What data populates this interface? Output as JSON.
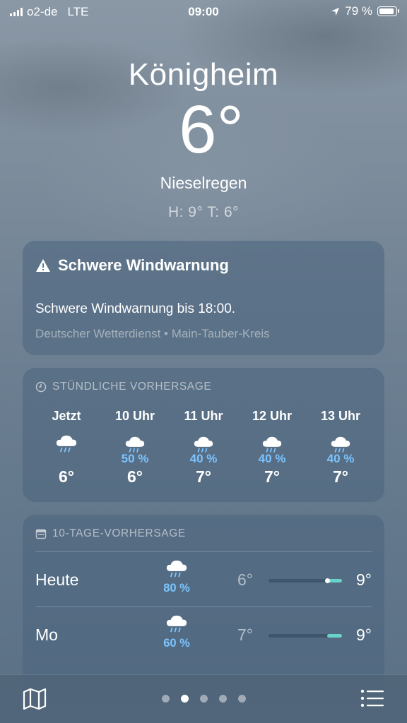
{
  "status_bar": {
    "carrier": "o2-de",
    "network": "LTE",
    "time": "09:00",
    "battery": "79 %"
  },
  "header": {
    "city": "Königheim",
    "temperature": "6°",
    "condition": "Nieselregen",
    "high_low": "H: 9°  T: 6°"
  },
  "alert": {
    "title": "Schwere Windwarnung",
    "text": "Schwere Windwarnung bis 18:00.",
    "source": "Deutscher Wetterdienst • Main-Tauber-Kreis"
  },
  "hourly": {
    "title": "STÜNDLICHE VORHERSAGE",
    "hours": [
      {
        "label": "Jetzt",
        "icon": "rain-cloud-icon",
        "precip": "",
        "temp": "6°"
      },
      {
        "label": "10 Uhr",
        "icon": "rain-cloud-icon",
        "precip": "50 %",
        "temp": "6°"
      },
      {
        "label": "11 Uhr",
        "icon": "rain-cloud-icon",
        "precip": "40 %",
        "temp": "7°"
      },
      {
        "label": "12 Uhr",
        "icon": "rain-cloud-icon",
        "precip": "40 %",
        "temp": "7°"
      },
      {
        "label": "13 Uhr",
        "icon": "rain-cloud-icon",
        "precip": "40 %",
        "temp": "7°"
      }
    ]
  },
  "daily": {
    "title": "10-TAGE-VORHERSAGE",
    "days": [
      {
        "name": "Heute",
        "icon": "rain-cloud-icon",
        "precip": "80 %",
        "low": "6°",
        "high": "9°",
        "range_start": 0.8,
        "range_end": 1.0,
        "current": 0.8
      },
      {
        "name": "Mo",
        "icon": "rain-cloud-icon",
        "precip": "60 %",
        "low": "7°",
        "high": "9°",
        "range_start": 0.8,
        "range_end": 1.0
      }
    ]
  },
  "toolbar": {
    "page_count": 5,
    "active_page": 1
  },
  "colors": {
    "precip": "#7cc4ff",
    "temp_bar": "#68d3c8"
  }
}
